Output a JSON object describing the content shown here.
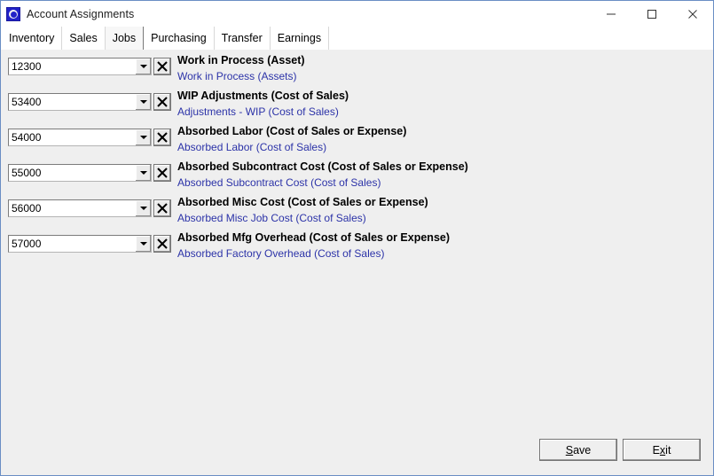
{
  "window": {
    "title": "Account Assignments",
    "icon": "app-blue-circle-icon",
    "border_color": "#6a8ec4",
    "controls": {
      "minimize": "minimize-icon",
      "maximize": "maximize-icon",
      "close": "close-icon"
    }
  },
  "tabs": [
    {
      "label": "Inventory",
      "active": false
    },
    {
      "label": "Sales",
      "active": false
    },
    {
      "label": "Jobs",
      "active": true
    },
    {
      "label": "Purchasing",
      "active": false
    },
    {
      "label": "Transfer",
      "active": false
    },
    {
      "label": "Earnings",
      "active": false
    }
  ],
  "rows": [
    {
      "account": "12300",
      "title": "Work in Process (Asset)",
      "description": "Work in Process (Assets)",
      "arrow_icon": "chevron-down-icon",
      "clear_icon": "x-icon"
    },
    {
      "account": "53400",
      "title": "WIP Adjustments (Cost of Sales)",
      "description": "Adjustments - WIP (Cost of Sales)",
      "arrow_icon": "chevron-down-icon",
      "clear_icon": "x-icon"
    },
    {
      "account": "54000",
      "title": "Absorbed Labor (Cost of Sales or Expense)",
      "description": "Absorbed Labor (Cost of Sales)",
      "arrow_icon": "chevron-down-icon",
      "clear_icon": "x-icon"
    },
    {
      "account": "55000",
      "title": "Absorbed Subcontract Cost (Cost of Sales or Expense)",
      "description": "Absorbed Subcontract Cost (Cost of Sales)",
      "arrow_icon": "chevron-down-icon",
      "clear_icon": "x-icon"
    },
    {
      "account": "56000",
      "title": "Absorbed Misc Cost (Cost of Sales or Expense)",
      "description": "Absorbed Misc Job Cost (Cost of Sales)",
      "arrow_icon": "chevron-down-icon",
      "clear_icon": "x-icon"
    },
    {
      "account": "57000",
      "title": "Absorbed Mfg Overhead (Cost of Sales or Expense)",
      "description": "Absorbed Factory Overhead (Cost of Sales)",
      "arrow_icon": "chevron-down-icon",
      "clear_icon": "x-icon"
    }
  ],
  "footer": {
    "save": {
      "prefix": "",
      "accel": "S",
      "suffix": "ave"
    },
    "exit": {
      "prefix": "E",
      "accel": "x",
      "suffix": "it"
    }
  },
  "colors": {
    "link_text": "#2c33a8",
    "client_background": "#efefef",
    "title_background": "#ffffff"
  }
}
